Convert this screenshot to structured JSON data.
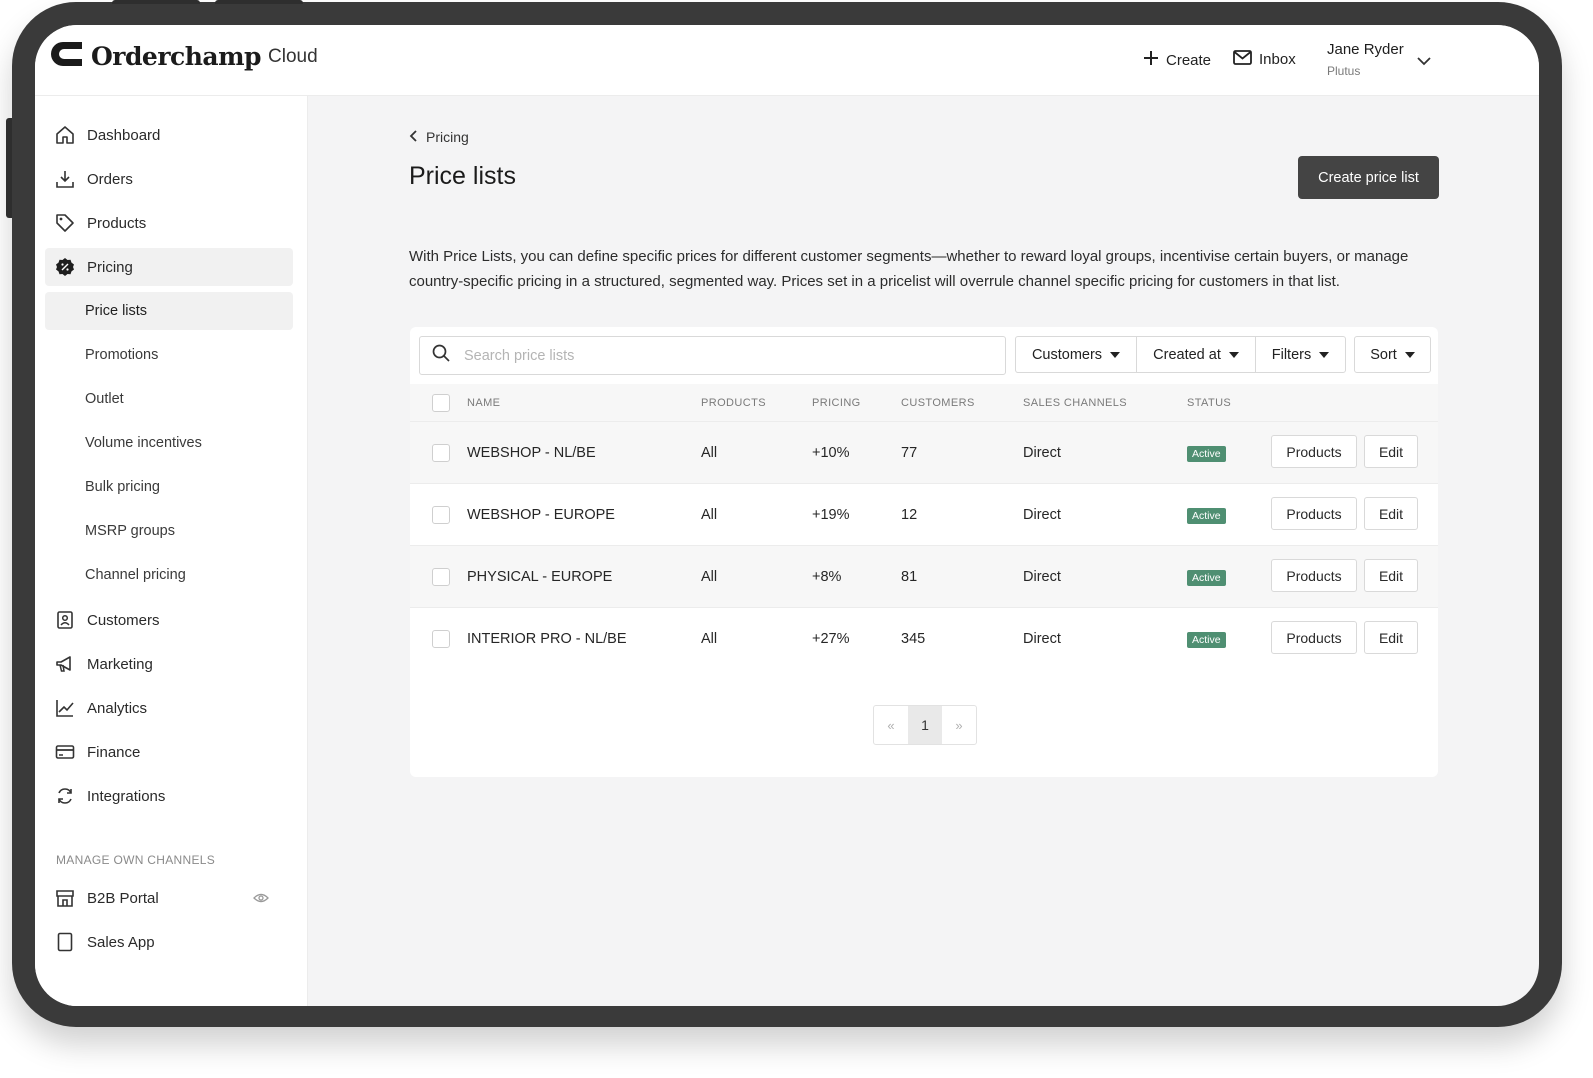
{
  "app": {
    "brand": "Orderchamp",
    "brand_suffix": "Cloud"
  },
  "header": {
    "create_label": "Create",
    "inbox_label": "Inbox",
    "user_name": "Jane Ryder",
    "user_org": "Plutus"
  },
  "sidebar": {
    "items": [
      {
        "label": "Dashboard",
        "icon": "home-icon"
      },
      {
        "label": "Orders",
        "icon": "download-tray-icon"
      },
      {
        "label": "Products",
        "icon": "tag-icon"
      },
      {
        "label": "Pricing",
        "icon": "discount-badge-icon"
      },
      {
        "label": "Customers",
        "icon": "contact-book-icon"
      },
      {
        "label": "Marketing",
        "icon": "megaphone-icon"
      },
      {
        "label": "Analytics",
        "icon": "line-chart-icon"
      },
      {
        "label": "Finance",
        "icon": "credit-card-icon"
      },
      {
        "label": "Integrations",
        "icon": "refresh-icon"
      }
    ],
    "pricing_subitems": [
      "Price lists",
      "Promotions",
      "Outlet",
      "Volume incentives",
      "Bulk pricing",
      "MSRP groups",
      "Channel pricing"
    ],
    "section_label": "MANAGE OWN CHANNELS",
    "channels": [
      {
        "label": "B2B Portal",
        "icon": "storefront-icon"
      },
      {
        "label": "Sales App",
        "icon": "tablet-icon"
      }
    ]
  },
  "page": {
    "breadcrumb": "Pricing",
    "title": "Price lists",
    "create_button": "Create price list",
    "description": "With Price Lists, you can define specific prices for different customer segments—whether to reward loyal groups, incentivise certain buyers, or manage country-specific pricing in a structured, segmented way. Prices set in a pricelist will overrule channel specific pricing for customers in that list."
  },
  "toolbar": {
    "search_placeholder": "Search price lists",
    "filters": [
      "Customers",
      "Created at",
      "Filters",
      "Sort"
    ]
  },
  "table": {
    "columns": [
      "NAME",
      "PRODUCTS",
      "PRICING",
      "CUSTOMERS",
      "SALES CHANNELS",
      "STATUS"
    ],
    "rows": [
      {
        "name": "WEBSHOP - NL/BE",
        "products": "All",
        "pricing": "+10%",
        "customers": "77",
        "channel": "Direct",
        "status": "Active"
      },
      {
        "name": "WEBSHOP - EUROPE",
        "products": "All",
        "pricing": "+19%",
        "customers": "12",
        "channel": "Direct",
        "status": "Active"
      },
      {
        "name": "PHYSICAL - EUROPE",
        "products": "All",
        "pricing": "+8%",
        "customers": "81",
        "channel": "Direct",
        "status": "Active"
      },
      {
        "name": "INTERIOR PRO - NL/BE",
        "products": "All",
        "pricing": "+27%",
        "customers": "345",
        "channel": "Direct",
        "status": "Active"
      }
    ],
    "row_actions": {
      "products": "Products",
      "edit": "Edit"
    }
  },
  "pagination": {
    "prev": "«",
    "current": "1",
    "next": "»"
  },
  "colors": {
    "status_active": "#4f8f72",
    "primary_button": "#444444"
  }
}
